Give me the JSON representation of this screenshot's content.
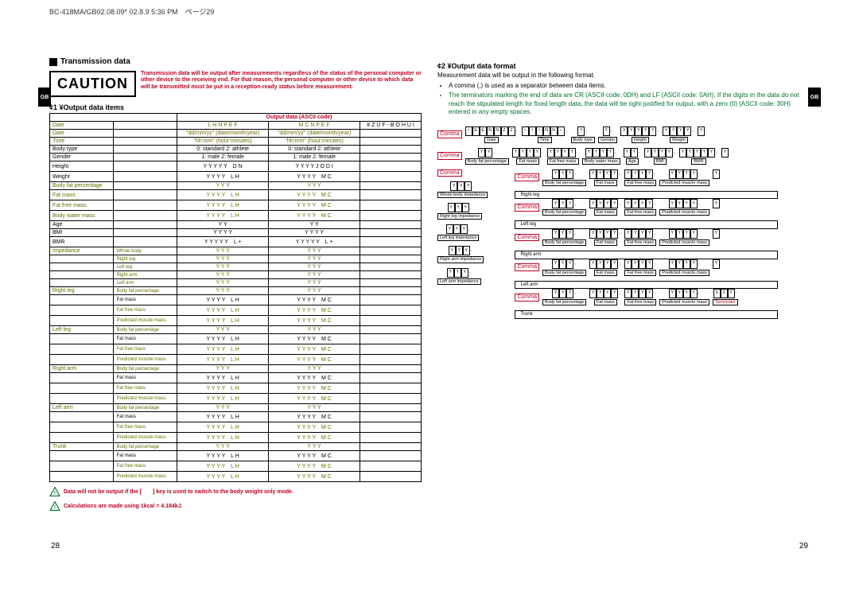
{
  "header": "BC-418MA/GB02.08.09* 02.8.9 5:36 PM　ページ29",
  "side_tab": "GB",
  "left": {
    "section": "Transmission data",
    "caution_label": "CAUTION",
    "caution_body": "Transmission data will be output after measurements regardless of the status of the personal computer or other device to the receiving end. For that reason, the personal computer or other device to which data will be transmitted must be put in a reception-ready status before measurement.",
    "sub1": "¢1 ¥Output data items",
    "table_head_center": "Output data (ASCII code)",
    "notes": [
      "Data will not be output if the [　　] key is used to switch to the body weight only mode.",
      "Calculations are made using 1kcal = 4.184kJ."
    ],
    "rows": [
      {
        "a": "Date",
        "b": "",
        "c": "L H  N P E F",
        "d": "M C  N P E F",
        "e": "# Z U F  - B O H U I",
        "cls": "olive"
      },
      {
        "a": "Date",
        "b": "",
        "c": "\"dd/mm/yy\" (date/month/year)",
        "d": "\"dd/mm/yy\" (date/month/year)",
        "e": "",
        "cls": "olive"
      },
      {
        "a": "Time",
        "b": "",
        "c": "\"hh:mm\" (hour:minutes)",
        "d": "\"hh:mm\" (hour:minutes)",
        "e": "",
        "cls": "olive"
      },
      {
        "a": "Body type",
        "b": "",
        "c": "0: standard 2: athlete",
        "d": "0: standard 2: athlete",
        "e": ""
      },
      {
        "a": "Gender",
        "b": "",
        "c": "1: male 2: female",
        "d": "1: male 2: female",
        "e": ""
      },
      {
        "a": "Height",
        "b": "",
        "c": "Y Y Y Y Y　D N",
        "d": "Y Y Y  Y   J O D I",
        "e": ""
      },
      {
        "a": "Weight",
        "b": "",
        "c": "Y Y Y Y　L H",
        "d": "Y Y Y  Y　M C",
        "e": ""
      },
      {
        "a": "Body fat percentage",
        "b": "",
        "c": "Y Y  Y",
        "d": "Y Y  Y",
        "e": "",
        "cls": "olive"
      },
      {
        "a": "Fat mass",
        "b": "",
        "c": "Y Y Y  Y　L H",
        "d": "Y Y Y  Y　M C",
        "e": "",
        "cls": "olive"
      },
      {
        "a": "Fat free mass",
        "b": "",
        "c": "Y Y Y  Y　L H",
        "d": "Y Y Y  Y　M C",
        "e": "",
        "cls": "olive"
      },
      {
        "a": "Body water mass",
        "b": "",
        "c": "Y Y Y  Y　L H",
        "d": "Y Y Y  Y　M C",
        "e": "",
        "cls": "olive"
      },
      {
        "a": "Age",
        "b": "",
        "c": "Y Y",
        "d": "Y Y",
        "e": ""
      },
      {
        "a": "BMI",
        "b": "",
        "c": "Y Y Y  Y",
        "d": "Y Y Y  Y",
        "e": ""
      },
      {
        "a": "BMR",
        "b": "",
        "c": "Y Y Y Y Y　L +",
        "d": "Y Y Y Y Y　L +",
        "e": ""
      },
      {
        "a": "Impedance",
        "b": "Whole body",
        "c": "Y Y Y",
        "d": "Y Y Y",
        "e": "",
        "cls": "olive"
      },
      {
        "a": "",
        "b": "Right leg",
        "c": "Y Y Y",
        "d": "Y Y Y",
        "e": "",
        "cls": "olive"
      },
      {
        "a": "",
        "b": "Left leg",
        "c": "Y Y Y",
        "d": "Y Y Y",
        "e": "",
        "cls": "olive"
      },
      {
        "a": "",
        "b": "Right arm",
        "c": "Y Y Y",
        "d": "Y Y Y",
        "e": "",
        "cls": "olive"
      },
      {
        "a": "",
        "b": "Left arm",
        "c": "Y Y Y",
        "d": "Y Y Y",
        "e": "",
        "cls": "olive"
      },
      {
        "a": "Right leg",
        "b": "Body fat percentage",
        "c": "Y Y  Y",
        "d": "Y Y  Y",
        "e": "",
        "cls": "olive"
      },
      {
        "a": "",
        "b": "Fat mass",
        "c": "Y Y Y  Y　L H",
        "d": "Y Y Y  Y　M C",
        "e": ""
      },
      {
        "a": "",
        "b": "Fat free mass",
        "c": "Y Y Y  Y　L H",
        "d": "Y Y Y  Y　M C",
        "e": "",
        "cls": "olive"
      },
      {
        "a": "",
        "b": "Predicted muscle mass",
        "c": "Y Y Y  Y　L H",
        "d": "Y Y Y  Y　M C",
        "e": "",
        "cls": "olive"
      },
      {
        "a": "Left leg",
        "b": "Body fat percentage",
        "c": "Y Y  Y",
        "d": "Y Y  Y",
        "e": "",
        "cls": "olive"
      },
      {
        "a": "",
        "b": "Fat mass",
        "c": "Y Y Y  Y　L H",
        "d": "Y Y Y  Y　M C",
        "e": ""
      },
      {
        "a": "",
        "b": "Fat free mass",
        "c": "Y Y Y  Y　L H",
        "d": "Y Y Y  Y　M C",
        "e": "",
        "cls": "olive"
      },
      {
        "a": "",
        "b": "Predicted muscle mass",
        "c": "Y Y Y  Y　L H",
        "d": "Y Y Y  Y　M C",
        "e": "",
        "cls": "olive"
      },
      {
        "a": "Right arm",
        "b": "Body fat percentage",
        "c": "Y Y  Y",
        "d": "Y Y  Y",
        "e": "",
        "cls": "olive"
      },
      {
        "a": "",
        "b": "Fat mass",
        "c": "Y Y Y  Y　L H",
        "d": "Y Y Y  Y　M C",
        "e": ""
      },
      {
        "a": "",
        "b": "Fat free mass",
        "c": "Y Y Y  Y　L H",
        "d": "Y Y Y  Y　M C",
        "e": "",
        "cls": "olive"
      },
      {
        "a": "",
        "b": "Predicted muscle mass",
        "c": "Y Y Y  Y　L H",
        "d": "Y Y Y  Y　M C",
        "e": "",
        "cls": "olive"
      },
      {
        "a": "Left arm",
        "b": "Body fat percentage",
        "c": "Y Y  Y",
        "d": "Y Y  Y",
        "e": "",
        "cls": "olive"
      },
      {
        "a": "",
        "b": "Fat mass",
        "c": "Y Y Y  Y　L H",
        "d": "Y Y Y  Y　M C",
        "e": ""
      },
      {
        "a": "",
        "b": "Fat free mass",
        "c": "Y Y Y  Y　L H",
        "d": "Y Y Y  Y　M C",
        "e": "",
        "cls": "olive"
      },
      {
        "a": "",
        "b": "Predicted muscle mass",
        "c": "Y Y Y  Y　L H",
        "d": "Y Y Y  Y　M C",
        "e": "",
        "cls": "olive"
      },
      {
        "a": "Trunk",
        "b": "Body fat percentage",
        "c": "Y Y  Y",
        "d": "Y Y  Y",
        "e": "",
        "cls": "olive"
      },
      {
        "a": "",
        "b": "Fat mass",
        "c": "Y Y Y  Y　L H",
        "d": "Y Y Y  Y　M C",
        "e": ""
      },
      {
        "a": "",
        "b": "Fat free mass",
        "c": "Y Y Y  Y　L H",
        "d": "Y Y Y  Y　M C",
        "e": "",
        "cls": "olive"
      },
      {
        "a": "",
        "b": "Predicted muscle mass",
        "c": "Y Y Y  Y　L H",
        "d": "Y Y Y  Y　M C",
        "e": "",
        "cls": "olive"
      }
    ],
    "pagenum": "28"
  },
  "right": {
    "sub2": "¢2 ¥Output data format",
    "intro": "Measurement data will be output in the following format.",
    "bullets": [
      "A comma (,) is used as a separator between data items.",
      "The terminators marking the end of data are CR (ASCII code: 0DH) and LF (ASCII code: 0AH). If the digits in the data do not reach the stipulated length for fixed length data, the data will be right-justified for output, with a zero (0) (ASCII code: 30H) entered in any empty spaces."
    ],
    "comma": "Comma",
    "terminator": "Terminator",
    "row1": [
      {
        "boxes": [
          "i",
          "E",
          "E",
          "N",
          "N",
          "Z",
          "Z"
        ],
        "label": "Date"
      },
      {
        "boxes": [
          "i",
          "I",
          "I",
          "N",
          "N",
          "i"
        ],
        "label": "Time"
      },
      {
        "boxes": [
          "Y"
        ],
        "label": "Body type"
      },
      {
        "boxes": [
          "Y"
        ],
        "label": "Gender"
      },
      {
        "boxes": [
          "Y",
          "Y",
          "Y",
          "Y",
          "Y"
        ],
        "label": "Height"
      },
      {
        "boxes": [
          "Y",
          "Y",
          "Y",
          "Y"
        ],
        "label": "Weight"
      }
    ],
    "row2": [
      {
        "boxes": [
          "Y",
          "Y"
        ],
        "label": "Body fat percentage"
      },
      {
        "boxes": [
          "Y",
          "Y",
          "Y",
          "Y"
        ],
        "label": "Fat mass"
      },
      {
        "boxes": [
          "Y",
          "Y",
          "Y",
          "Y"
        ],
        "label": "Fat free mass"
      },
      {
        "boxes": [
          "Y",
          "Y",
          "Y",
          "Y"
        ],
        "label": "Body water mass"
      },
      {
        "boxes": [
          "Y",
          "Y"
        ],
        "label": "Age"
      },
      {
        "boxes": [
          "Y",
          "Y",
          "Y",
          "Y"
        ],
        "label": "BMI"
      },
      {
        "boxes": [
          "Y",
          "Y",
          "Y",
          "Y",
          "Y"
        ],
        "label": "BMR"
      }
    ],
    "imp_rows": [
      {
        "boxes": [
          "Y",
          "Y",
          "Y"
        ],
        "label": "Whole body impedance"
      },
      {
        "boxes": [
          "Y",
          "Y",
          "Y"
        ],
        "label": "Right leg impedance"
      },
      {
        "boxes": [
          "Y",
          "Y",
          "Y"
        ],
        "label": "Left leg impedance"
      },
      {
        "boxes": [
          "Y",
          "Y",
          "Y"
        ],
        "label": "Right arm impedance"
      },
      {
        "boxes": [
          "Y",
          "Y",
          "Y"
        ],
        "label": "Left arm impedance"
      }
    ],
    "seg_rows": [
      {
        "name": "Right leg"
      },
      {
        "name": "Left leg"
      },
      {
        "name": "Right arm"
      },
      {
        "name": "Left arm"
      },
      {
        "name": "Trunk"
      }
    ],
    "seg_fields": [
      {
        "boxes": [
          "Y",
          "Y",
          "Y"
        ],
        "label": "Body fat percentage"
      },
      {
        "boxes": [
          "Y",
          "Y",
          "Y",
          "Y"
        ],
        "label": "Fat mass"
      },
      {
        "boxes": [
          "Y",
          "Y",
          "Y",
          "Y"
        ],
        "label": "Fat free mass"
      },
      {
        "boxes": [
          "Y",
          "Y",
          "Y",
          "Y"
        ],
        "label": "Predicted muscle mass"
      }
    ],
    "trunk_extra": {
      "boxes": [
        "S",
        "3",
        "Y"
      ],
      "label": ""
    },
    "pagenum": "29"
  }
}
